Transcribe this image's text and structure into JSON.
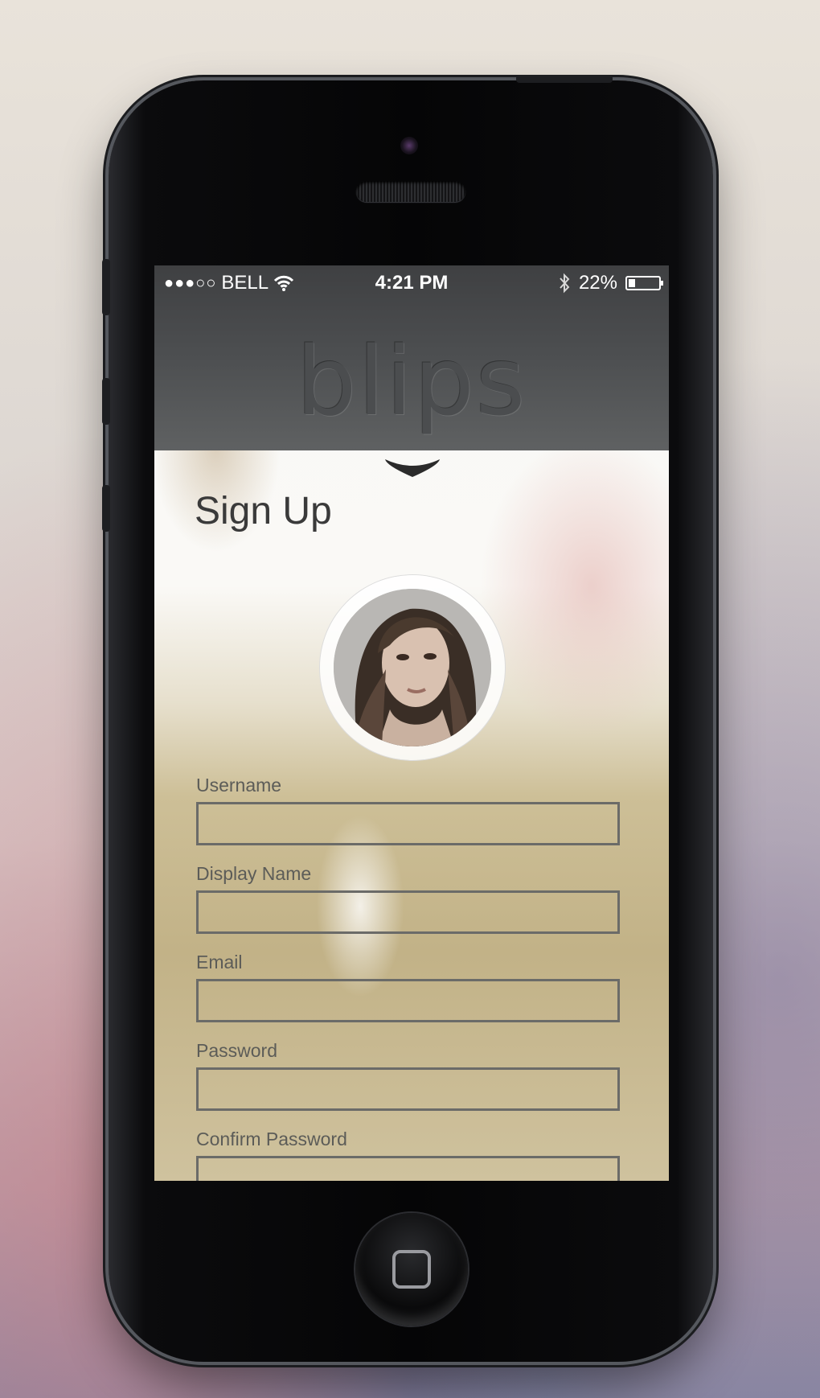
{
  "status_bar": {
    "signal": "●●●○○",
    "carrier": "BELL",
    "time": "4:21 PM",
    "battery": "22%",
    "battery_level": 0.22
  },
  "header": {
    "logo": "blips"
  },
  "page": {
    "title": "Sign Up"
  },
  "form": {
    "fields": [
      {
        "label": "Username",
        "value": ""
      },
      {
        "label": "Display Name",
        "value": ""
      },
      {
        "label": "Email",
        "value": ""
      },
      {
        "label": "Password",
        "value": ""
      },
      {
        "label": "Confirm Password",
        "value": ""
      }
    ]
  },
  "colors": {
    "header_bg": "#4d4f51",
    "field_border": "#6b6b68",
    "title_text": "#3a3a3a"
  },
  "icons": [
    "signal-icon",
    "wifi-icon",
    "bluetooth-icon",
    "battery-icon",
    "chevron-down-icon",
    "profile-avatar",
    "home-button-icon"
  ]
}
